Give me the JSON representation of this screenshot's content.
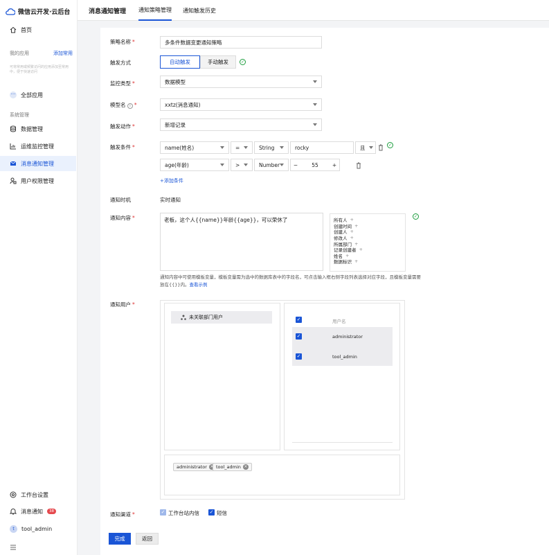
{
  "app": {
    "title": "微信云开发·云后台"
  },
  "sidebar": {
    "home": "首页",
    "my_apps": "我的应用",
    "add_common": "添加常用",
    "apps_hint": "可将常用或频繁访问的应用添加至常用中，便于快速访问",
    "all_apps": "全部应用",
    "system_title": "系统管理",
    "items": [
      "数据管理",
      "运维监控管理",
      "消息通知管理",
      "用户权限管理"
    ],
    "workbench_settings": "工作台设置",
    "notifications": "消息通知",
    "notif_count": "38",
    "user_name": "tool_admin",
    "user_initial": "t"
  },
  "tabs": [
    "消息通知管理",
    "通知策略管理",
    "通知触发历史"
  ],
  "form": {
    "name_label": "策略名称",
    "name_value": "多条件数据变更通知策略",
    "trigger_label": "触发方式",
    "trigger_auto": "自动触发",
    "trigger_manual": "手动触发",
    "monitor_label": "监控类型",
    "monitor_value": "数据模型",
    "model_label": "模型名",
    "model_value": "xxtz(消息通知)",
    "action_label": "触发动作",
    "action_value": "新增记录",
    "condition_label": "触发条件",
    "conditions": [
      {
        "field": "name(姓名)",
        "op": "=",
        "type": "String",
        "value": "rocky",
        "logic": "且"
      },
      {
        "field": "age(年龄)",
        "op": ">",
        "type": "Number",
        "value": "55"
      }
    ],
    "add_condition": "+添加条件",
    "time_label": "通知时机",
    "time_value": "实时通知",
    "content_label": "通知内容",
    "content_value": "老板，这个人{{name}}年龄{{age}}，可以荣休了",
    "variables": [
      "所有人",
      "创建时间",
      "创建人",
      "修改人",
      "所属部门",
      "记录创建者",
      "姓名",
      "数据标识"
    ],
    "content_hint": "通知内容中可使用模板变量，模板变量需为选中的数据库表中的字段名，可点击输入框右侧字段列表选择对应字段，且模板变量需要放在{{}}内。",
    "content_example": "查看示例",
    "users_label": "通知用户",
    "dept_node": "未关联部门用户",
    "user_col": "用户名",
    "users": [
      "administrator",
      "tool_admin"
    ],
    "selected_tags": [
      "administrator",
      "tool_admin"
    ],
    "channel_label": "通知渠道",
    "channels": [
      "工作台站内信",
      "短信"
    ],
    "submit": "完成",
    "back": "返回"
  },
  "colors": {
    "accent": "#1a55d6",
    "success": "#1a9d3c",
    "badge": "#e5484d"
  }
}
